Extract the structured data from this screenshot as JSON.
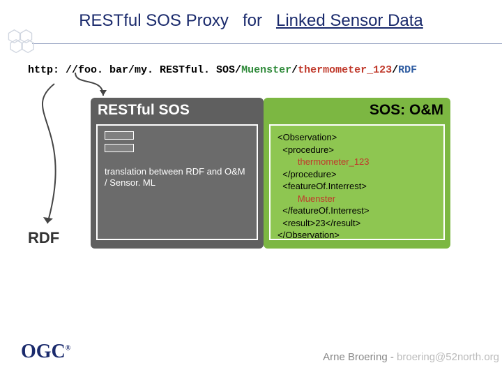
{
  "title": {
    "part1": "RESTful SOS Proxy",
    "part2": "for",
    "part3": "Linked Sensor Data"
  },
  "url": {
    "base": "http: //foo. bar/my. RESTful. SOS/",
    "seg1": "Muenster",
    "sep1": "/",
    "seg2": "thermometer_123",
    "sep2": "/",
    "seg3": "RDF"
  },
  "restful": {
    "heading": "RESTful SOS",
    "translation": "translation between RDF and O&M / Sensor. ML"
  },
  "om": {
    "heading": "SOS: O&M",
    "xml": {
      "l1": "<Observation>",
      "l2": "  <procedure>",
      "l3": "    thermometer_123",
      "l4": "  </procedure>",
      "l5": "  <featureOf.Interrest>",
      "l6": "    Muenster",
      "l7": "  </featureOf.Interrest>",
      "l8": "  <result>23</result>",
      "l9": "</Observation>"
    }
  },
  "rdf_label": "RDF",
  "footer": {
    "logo": "OGC",
    "reg": "®",
    "author": "Arne Broering",
    "sep": "  -  ",
    "email": "broering@52north.org"
  }
}
